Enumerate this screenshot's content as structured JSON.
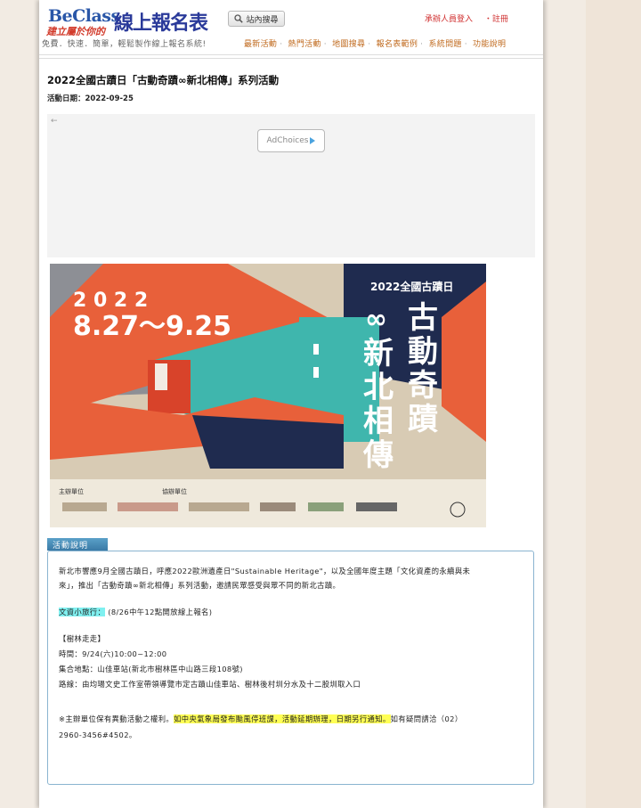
{
  "header": {
    "logo_en": "BeClass",
    "logo_zh": "線上報名表",
    "slogan": "建立屬於你的",
    "tagline": "免費．快速．簡單，輕鬆製作線上報名系統!",
    "search_label": "站內搜尋",
    "login_label": "承辦人員登入",
    "register_label": "・註冊",
    "nav": [
      "最新活動",
      "熱門活動",
      "地圖搜尋",
      "報名表範例",
      "系統問題",
      "功能說明"
    ]
  },
  "event": {
    "title": "2022全國古蹟日「古動奇蹟∞新北相傳」系列活動",
    "date_label": "活動日期：2022-09-25"
  },
  "ad": {
    "arrow": "←",
    "choices_label": "AdChoices"
  },
  "poster": {
    "year": "2 0 2 2",
    "dates": "8.27～9.25",
    "headline": "2022全國古蹟日",
    "title_right": [
      "古",
      "動",
      "奇",
      "蹟"
    ],
    "title_left": [
      "新",
      "北",
      "相",
      "傳"
    ],
    "infinity": "∞",
    "organizer_label": "主辦單位",
    "sponsor_label": "協辦單位"
  },
  "description": {
    "tab_label": "活動說明",
    "intro_1": "新北市響應9月全國古蹟日，呼應2022歐洲遺產日\"Sustainable  Heritage\"，以及全國年度主題「文化資產的永續與未",
    "intro_2": "來」，推出「古動奇蹟∞新北相傳」系列活動，邀請民眾感受與眾不同的新北古蹟。",
    "tour_label": "文資小旅行：",
    "tour_note": "(8/26中午12點開放線上報名)",
    "route_title": "【樹林走走】",
    "time": "時間：9/24(六)10:00~12:00",
    "place": "集合地點：山佳車站(新北市樹林區中山路三段108號)",
    "route": "路線：由均瑒文史工作室帶領導覽市定古蹟山佳車站、樹林後村圳分水及十二股圳取入口",
    "note_prefix": "※主辦單位保有異動活動之權利。",
    "note_highlight": "如中央氣象局發布颱風停班課，活動延期辦理，日期另行通知。",
    "note_suffix": "如有疑問請洽（02）",
    "phone": "2960-3456#4502。"
  },
  "colors": {
    "poster_orange": "#e8603a",
    "poster_navy": "#1f2b4f",
    "poster_teal": "#3fb6ad",
    "poster_beige": "#d8cbb4",
    "poster_gray": "#8d8f95"
  }
}
